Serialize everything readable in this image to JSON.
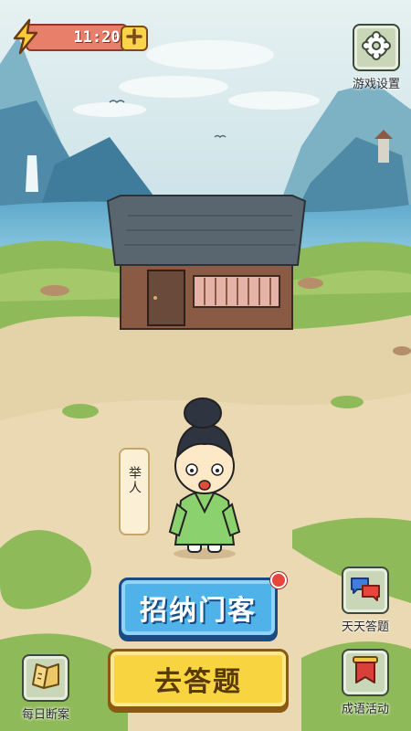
{
  "status": {
    "energy_icon": "lightning-bolt-icon",
    "timer": "11:20",
    "add_icon": "plus-icon"
  },
  "top_right": {
    "settings_label": "游戏设置",
    "settings_icon": "gear-icon"
  },
  "character": {
    "rank_label": "举人"
  },
  "main_buttons": {
    "recruit_label": "招纳门客",
    "quiz_label": "去答题"
  },
  "side_buttons": {
    "daily_quiz_label": "天天答题",
    "daily_quiz_icon": "chat-bubbles-icon",
    "daily_case_label": "每日断案",
    "daily_case_icon": "scroll-icon",
    "idiom_label": "成语活动",
    "idiom_icon": "banner-icon"
  },
  "colors": {
    "sky": "#cde4ea",
    "mountain": "#5a97b3",
    "grass": "#8fba5a",
    "ground": "#e4d2a8",
    "recruit_button": "#4fb3ea",
    "quiz_button": "#f8d441"
  }
}
